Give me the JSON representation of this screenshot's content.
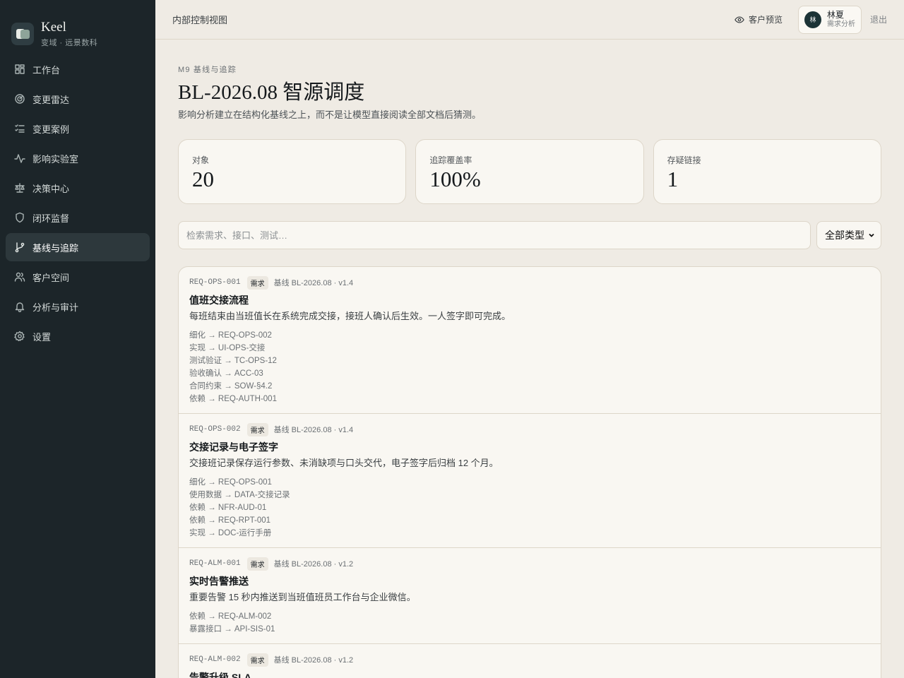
{
  "brand": {
    "name": "Keel",
    "subtitle": "变域 · 远景数科"
  },
  "nav": [
    {
      "label": "工作台",
      "icon": "dashboard-icon"
    },
    {
      "label": "变更雷达",
      "icon": "radar-icon"
    },
    {
      "label": "变更案例",
      "icon": "checklist-icon"
    },
    {
      "label": "影响实验室",
      "icon": "activity-icon"
    },
    {
      "label": "决策中心",
      "icon": "scale-icon"
    },
    {
      "label": "闭环监督",
      "icon": "shield-icon"
    },
    {
      "label": "基线与追踪",
      "icon": "git-branch-icon",
      "active": true
    },
    {
      "label": "客户空间",
      "icon": "users-icon"
    },
    {
      "label": "分析与审计",
      "icon": "bell-icon"
    },
    {
      "label": "设置",
      "icon": "gear-icon"
    }
  ],
  "topbar": {
    "title": "内部控制视图",
    "preview_label": "客户预览",
    "user": {
      "avatar": "林",
      "name": "林夏",
      "role": "需求分析"
    },
    "logout_label": "退出"
  },
  "page": {
    "eyebrow": "M9 基线与追踪",
    "title": "BL-2026.08 智源调度",
    "description": "影响分析建立在结构化基线之上，而不是让模型直接阅读全部文档后猜测。"
  },
  "stats": [
    {
      "label": "对象",
      "value": "20"
    },
    {
      "label": "追踪覆盖率",
      "value": "100%"
    },
    {
      "label": "存疑链接",
      "value": "1"
    }
  ],
  "filter": {
    "search_placeholder": "检索需求、接口、测试…",
    "type_selected": "全部类型"
  },
  "items": [
    {
      "id": "REQ-OPS-001",
      "tag": "需求",
      "baseline": "基线 BL-2026.08 · v1.4",
      "title": "值班交接流程",
      "description": "每班结束由当班值长在系统完成交接，接班人确认后生效。一人签字即可完成。",
      "links": [
        "细化 → REQ-OPS-002",
        "实现 → UI-OPS-交接",
        "测试验证 → TC-OPS-12",
        "验收确认 → ACC-03",
        "合同约束 → SOW-§4.2",
        "依赖 → REQ-AUTH-001"
      ]
    },
    {
      "id": "REQ-OPS-002",
      "tag": "需求",
      "baseline": "基线 BL-2026.08 · v1.4",
      "title": "交接记录与电子签字",
      "description": "交接班记录保存运行参数、未消缺项与口头交代，电子签字后归档 12 个月。",
      "links": [
        "细化 → REQ-OPS-001",
        "使用数据 → DATA-交接记录",
        "依赖 → NFR-AUD-01",
        "依赖 → REQ-RPT-001",
        "实现 → DOC-运行手册"
      ]
    },
    {
      "id": "REQ-ALM-001",
      "tag": "需求",
      "baseline": "基线 BL-2026.08 · v1.2",
      "title": "实时告警推送",
      "description": "重要告警 15 秒内推送到当班值班员工作台与企业微信。",
      "links": [
        "依赖 → REQ-ALM-002",
        "暴露接口 → API-SIS-01"
      ]
    },
    {
      "id": "REQ-ALM-002",
      "tag": "需求",
      "baseline": "基线 BL-2026.08 · v1.2",
      "title": "告警升级 SLA",
      "description": "",
      "links": []
    }
  ]
}
